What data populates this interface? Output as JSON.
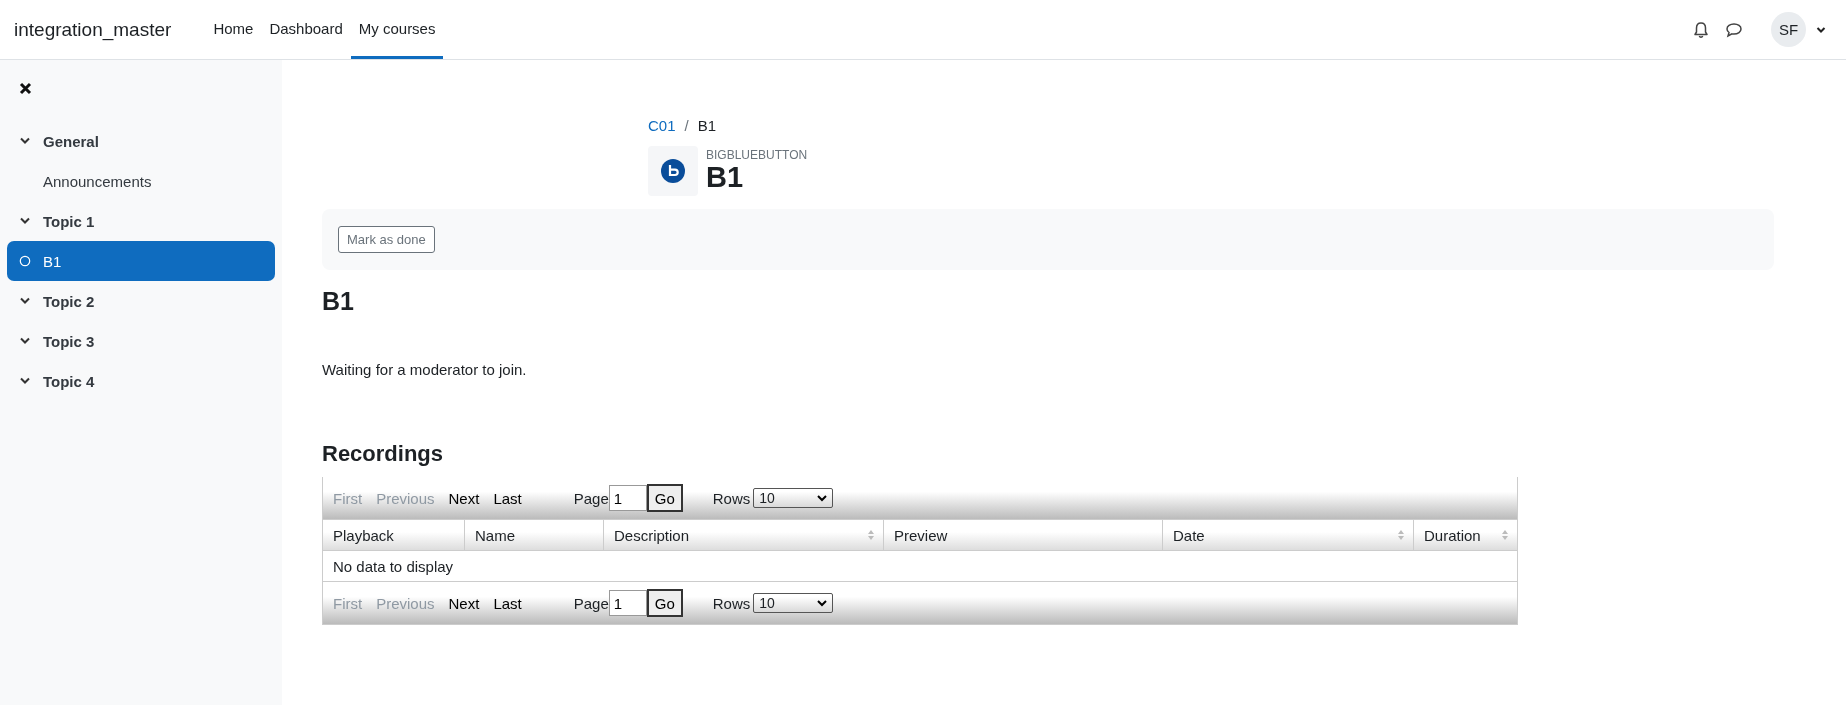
{
  "site_name": "integration_master",
  "nav": [
    {
      "label": "Home",
      "selected": false
    },
    {
      "label": "Dashboard",
      "selected": false
    },
    {
      "label": "My courses",
      "selected": true
    }
  ],
  "user": {
    "initials": "SF"
  },
  "sidebar": {
    "sections": [
      {
        "label": "General",
        "expanded": true,
        "children": [
          {
            "label": "Announcements",
            "selected": false,
            "completion": false
          }
        ]
      },
      {
        "label": "Topic 1",
        "expanded": true,
        "children": [
          {
            "label": "B1",
            "selected": true,
            "completion": true
          }
        ]
      },
      {
        "label": "Topic 2",
        "expanded": true
      },
      {
        "label": "Topic 3",
        "expanded": true
      },
      {
        "label": "Topic 4",
        "expanded": true
      }
    ]
  },
  "breadcrumb_separator": "/",
  "breadcrumb": [
    {
      "label": "C01",
      "kind": "link"
    },
    {
      "label": "B1",
      "kind": "current"
    }
  ],
  "activity": {
    "type_label": "BIGBLUEBUTTON",
    "title": "B1"
  },
  "mark_done_button": "Mark as done",
  "heading": "B1",
  "message": "Waiting for a moderator to join.",
  "recordings": {
    "title": "Recordings",
    "pager_top": {
      "links": [
        {
          "label": "First",
          "disabled": true
        },
        {
          "label": "Previous",
          "disabled": true
        },
        {
          "label": "Next",
          "disabled": false
        },
        {
          "label": "Last",
          "disabled": false
        }
      ],
      "page_label": "Page",
      "page_value": "1",
      "go": "Go",
      "rows_label": "Rows",
      "rows_value": "10"
    },
    "columns": [
      {
        "label": "Playback",
        "sortable": false
      },
      {
        "label": "Name",
        "sortable": false
      },
      {
        "label": "Description",
        "sortable": true
      },
      {
        "label": "Preview",
        "sortable": false
      },
      {
        "label": "Date",
        "sortable": true
      },
      {
        "label": "Duration",
        "sortable": true
      }
    ],
    "empty_message": "No data to display",
    "pager_bottom": {
      "links": [
        {
          "label": "First",
          "disabled": true
        },
        {
          "label": "Previous",
          "disabled": true
        },
        {
          "label": "Next",
          "disabled": false
        },
        {
          "label": "Last",
          "disabled": false
        }
      ],
      "page_label": "Page",
      "page_value": "1",
      "go": "Go",
      "rows_label": "Rows",
      "rows_value": "10"
    }
  }
}
